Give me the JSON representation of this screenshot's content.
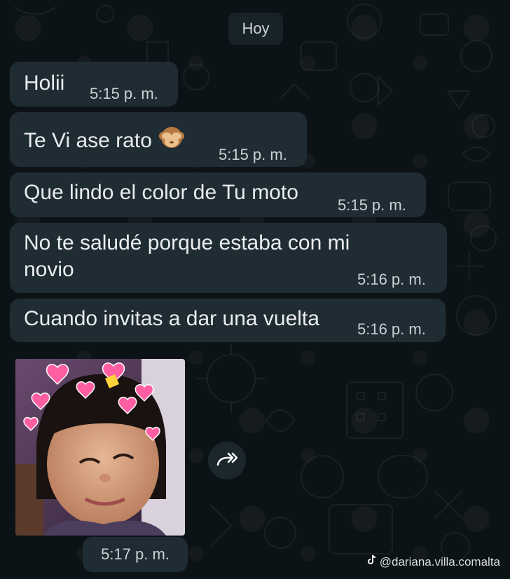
{
  "date_label": "Hoy",
  "messages": [
    {
      "text": "Holii",
      "time": "5:15 p. m."
    },
    {
      "text": "Te Vi ase rato",
      "time": "5:15 p. m.",
      "emoji": "see-no-evil-monkey"
    },
    {
      "text": "Que lindo el color de Tu moto",
      "time": "5:15 p. m."
    },
    {
      "text_line1": "No te saludé porque estaba con mi",
      "text_line2": "novio",
      "time": "5:16 p. m."
    },
    {
      "text": "Cuando invitas a dar una vuelta",
      "time": "5:16 p. m."
    }
  ],
  "image_message": {
    "time": "5:17 p. m.",
    "icon": "forward-icon"
  },
  "watermark": {
    "handle": "@dariana.villa.comalta",
    "icon": "tiktok-icon"
  },
  "colors": {
    "background": "#0c1317",
    "bubble": "#202c33",
    "text": "#e9edef",
    "meta": "#c9d1d5"
  }
}
